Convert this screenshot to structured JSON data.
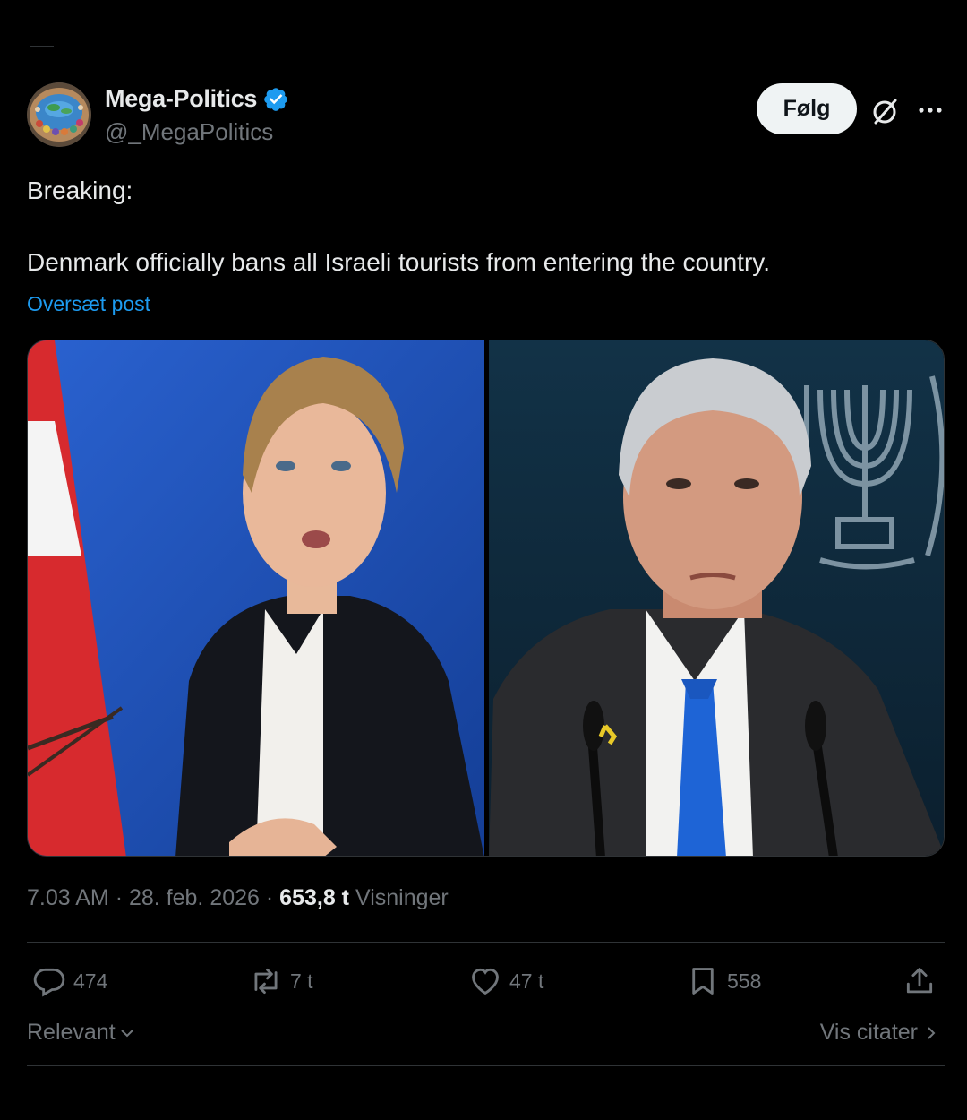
{
  "author": {
    "display_name": "Mega-Politics",
    "handle": "@_MegaPolitics",
    "verified": true
  },
  "header": {
    "follow_label": "Følg"
  },
  "post": {
    "text": "Breaking:\n\nDenmark officially bans all Israeli tourists from entering the country.",
    "translate_label": "Oversæt post"
  },
  "meta": {
    "time": "7.03 AM",
    "date": "28. feb. 2026",
    "views_count": "653,8 t",
    "views_label": "Visninger"
  },
  "actions": {
    "replies": "474",
    "reposts": "7 t",
    "likes": "47 t",
    "bookmarks": "558"
  },
  "footer": {
    "sort_label": "Relevant",
    "quotes_label": "Vis citater"
  },
  "colors": {
    "background": "#000000",
    "text": "#e7e9ea",
    "muted": "#71767b",
    "accent": "#1d9bf0",
    "divider": "#2f3336"
  },
  "icons": [
    "verified-badge-icon",
    "grok-icon",
    "more-icon",
    "reply-icon",
    "repost-icon",
    "like-icon",
    "bookmark-icon",
    "share-icon",
    "chevron-down-icon",
    "chevron-right-icon"
  ]
}
